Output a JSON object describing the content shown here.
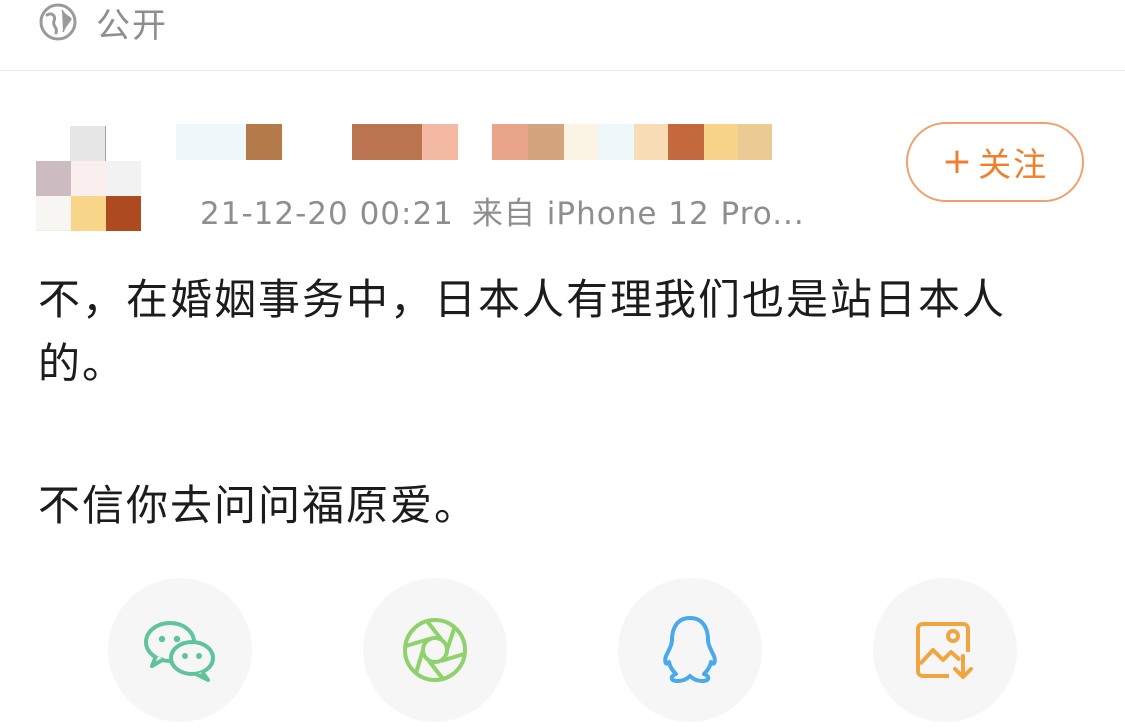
{
  "top_bar": {
    "visibility_icon": "globe-icon",
    "visibility_label": "公开"
  },
  "post": {
    "meta_time": "21-12-20 00:21",
    "meta_source": "来自 iPhone 12 Pro...",
    "follow_label": "关注",
    "follow_plus": "+",
    "paragraphs": [
      "不，在婚姻事务中，日本人有理我们也是站日本人的。",
      "不信你去问问福原爱。"
    ]
  },
  "share": {
    "items": [
      {
        "icon": "wechat-icon",
        "color": "#5fc49a"
      },
      {
        "icon": "moments-icon",
        "color": "#8fd16b"
      },
      {
        "icon": "qq-icon",
        "color": "#4aa8ec"
      },
      {
        "icon": "save-image-icon",
        "color": "#f0a640"
      }
    ]
  },
  "colors": {
    "accent": "#f07f2d",
    "follow_border": "#f0a06a",
    "meta_text": "#8e8e8e"
  }
}
